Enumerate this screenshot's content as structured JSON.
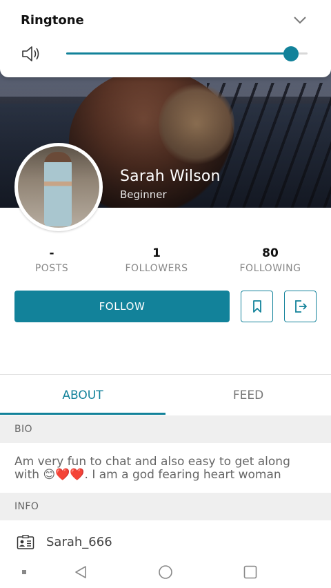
{
  "ringtone": {
    "title": "Ringtone",
    "volume": 0.93,
    "accent": "#12829a"
  },
  "profile": {
    "name": "Sarah Wilson",
    "level": "Beginner"
  },
  "stats": [
    {
      "value": "-",
      "label": "POSTS"
    },
    {
      "value": "1",
      "label": "FOLLOWERS"
    },
    {
      "value": "80",
      "label": "FOLLOWING"
    }
  ],
  "actions": {
    "follow_label": "FOLLOW",
    "bookmark_icon": "bookmark-icon",
    "logout_icon": "logout-icon"
  },
  "tabs": [
    {
      "label": "ABOUT",
      "active": true
    },
    {
      "label": "FEED",
      "active": false
    }
  ],
  "bio": {
    "heading": "BIO",
    "text": "Am very fun to chat and also easy to get along with 😊❤️❤️. I am a god fearing heart woman"
  },
  "info": {
    "heading": "INFO",
    "username": "Sarah_666",
    "username_icon": "id-card-icon"
  },
  "navbar": {
    "items": [
      "menu-dot-icon",
      "back-icon",
      "home-icon",
      "recents-icon"
    ]
  }
}
